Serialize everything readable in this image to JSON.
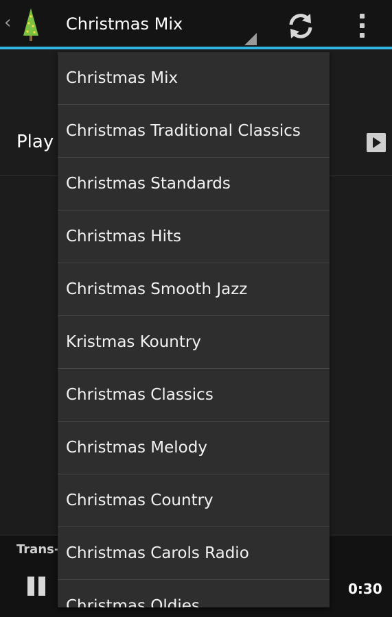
{
  "actionbar": {
    "back_caret": "‹",
    "title": "Christmas Mix",
    "app_icon": "christmas-tree-icon",
    "refresh_icon": "refresh-icon",
    "overflow_icon": "overflow-menu-icon",
    "accent_color": "#33b5e5"
  },
  "content": {
    "play_label": "Play",
    "play_icon": "play-icon",
    "now_playing_label": "Trans-",
    "elapsed_time": "0:30",
    "pause_icon": "pause-icon"
  },
  "dropdown": {
    "items": [
      "Christmas Mix",
      "Christmas Traditional Classics",
      "Christmas Standards",
      "Christmas Hits",
      "Christmas Smooth Jazz",
      "Kristmas Kountry",
      "Christmas Classics",
      "Christmas Melody",
      "Christmas Country",
      "Christmas Carols Radio",
      "Christmas Oldies"
    ]
  }
}
